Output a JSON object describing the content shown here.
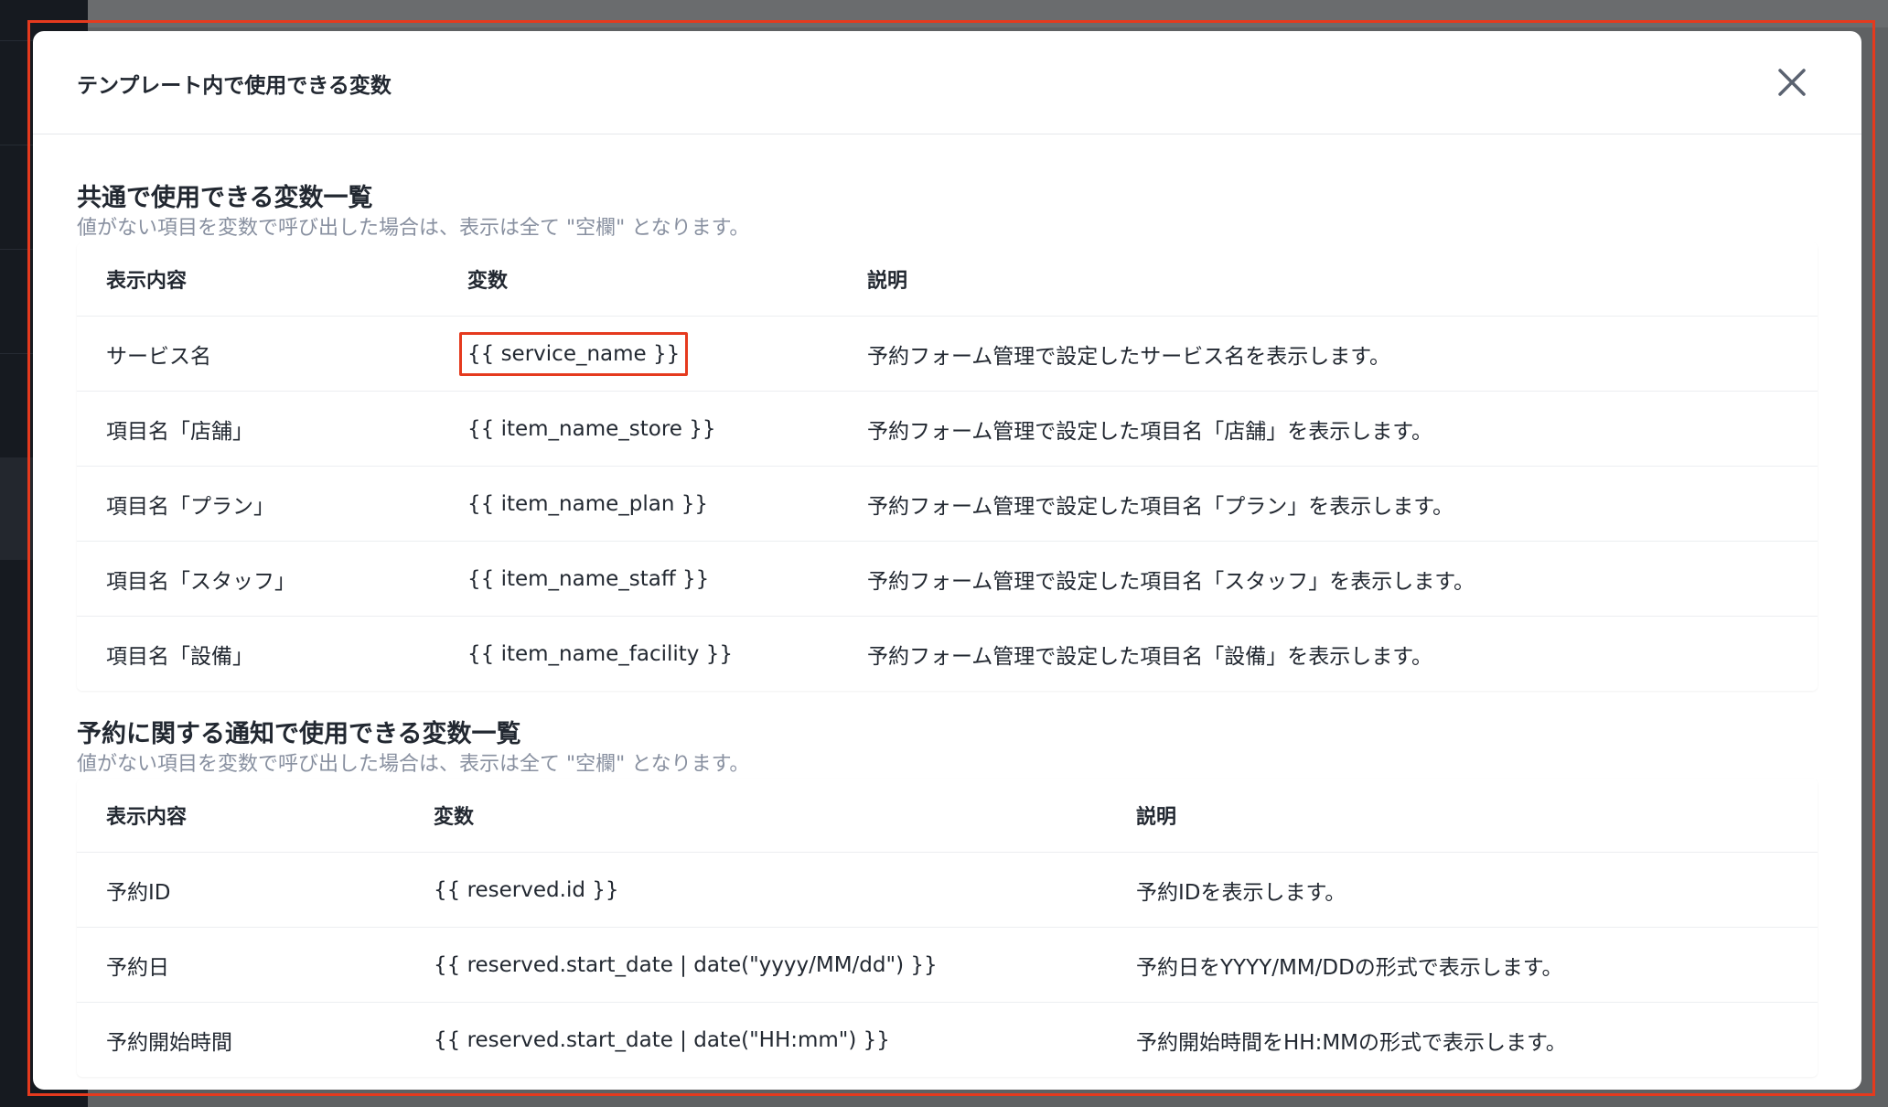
{
  "modal": {
    "title": "テンプレート内で使用できる変数"
  },
  "colors": {
    "highlight": "#e53a1e",
    "note_text": "#8890a0",
    "overlay": "#5f6163",
    "sidebar": "#161a20"
  },
  "icons": {
    "close": "close-icon"
  },
  "common": {
    "title": "共通で使用できる変数一覧",
    "note": "値がない項目を変数で呼び出した場合は、表示は全て \"空欄\" となります。",
    "headers": [
      "表示内容",
      "変数",
      "説明"
    ],
    "rows": [
      {
        "display": "サービス名",
        "variable": "{{ service_name }}",
        "description": "予約フォーム管理で設定したサービス名を表示します。",
        "highlighted": true
      },
      {
        "display": "項目名「店舗」",
        "variable": "{{ item_name_store }}",
        "description": "予約フォーム管理で設定した項目名「店舗」を表示します。"
      },
      {
        "display": "項目名「プラン」",
        "variable": "{{ item_name_plan }}",
        "description": "予約フォーム管理で設定した項目名「プラン」を表示します。"
      },
      {
        "display": "項目名「スタッフ」",
        "variable": "{{ item_name_staff }}",
        "description": "予約フォーム管理で設定した項目名「スタッフ」を表示します。"
      },
      {
        "display": "項目名「設備」",
        "variable": "{{ item_name_facility }}",
        "description": "予約フォーム管理で設定した項目名「設備」を表示します。"
      }
    ]
  },
  "reservation": {
    "title": "予約に関する通知で使用できる変数一覧",
    "note": "値がない項目を変数で呼び出した場合は、表示は全て \"空欄\" となります。",
    "headers": [
      "表示内容",
      "変数",
      "説明"
    ],
    "rows": [
      {
        "display": "予約ID",
        "variable": "{{ reserved.id }}",
        "description": "予約IDを表示します。"
      },
      {
        "display": "予約日",
        "variable": "{{ reserved.start_date | date(\"yyyy/MM/dd\") }}",
        "description": "予約日をYYYY/MM/DDの形式で表示します。"
      },
      {
        "display": "予約開始時間",
        "variable": "{{ reserved.start_date | date(\"HH:mm\") }}",
        "description": "予約開始時間をHH:MMの形式で表示します。"
      }
    ]
  }
}
